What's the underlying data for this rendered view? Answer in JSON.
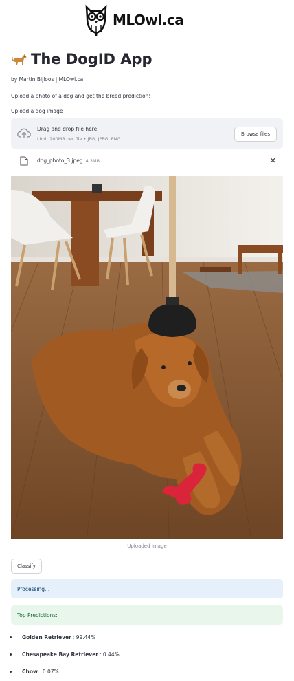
{
  "header": {
    "logo_text": "MLOwl.ca"
  },
  "app": {
    "title": "The DogID App",
    "byline": "by Martin Bijloos | MLOwl.ca",
    "intro": "Upload a photo of a dog and get the breed prediction!"
  },
  "uploader": {
    "label": "Upload a dog image",
    "drop_title": "Drag and drop file here",
    "drop_limit": "Limit 200MB per file • JPG, JPEG, PNG",
    "browse_label": "Browse files"
  },
  "file": {
    "name": "dog_photo_3.jpeg",
    "size": "4.3MB",
    "remove_glyph": "✕"
  },
  "image": {
    "caption": "Uploaded Image"
  },
  "actions": {
    "classify_label": "Classify"
  },
  "status": {
    "processing": "Processing...",
    "top_predictions": "Top Predictions:"
  },
  "predictions": [
    {
      "breed": "Golden Retriever",
      "pct": "99.44%"
    },
    {
      "breed": "Chesapeake Bay Retriever",
      "pct": "0.44%"
    },
    {
      "breed": "Chow",
      "pct": "0.07%"
    }
  ],
  "colors": {
    "info_bg": "#e6f0fb",
    "info_text": "#0b3f6f",
    "success_bg": "#e8f6ec",
    "success_text": "#176a33",
    "dropzone_bg": "#f0f2f6"
  }
}
